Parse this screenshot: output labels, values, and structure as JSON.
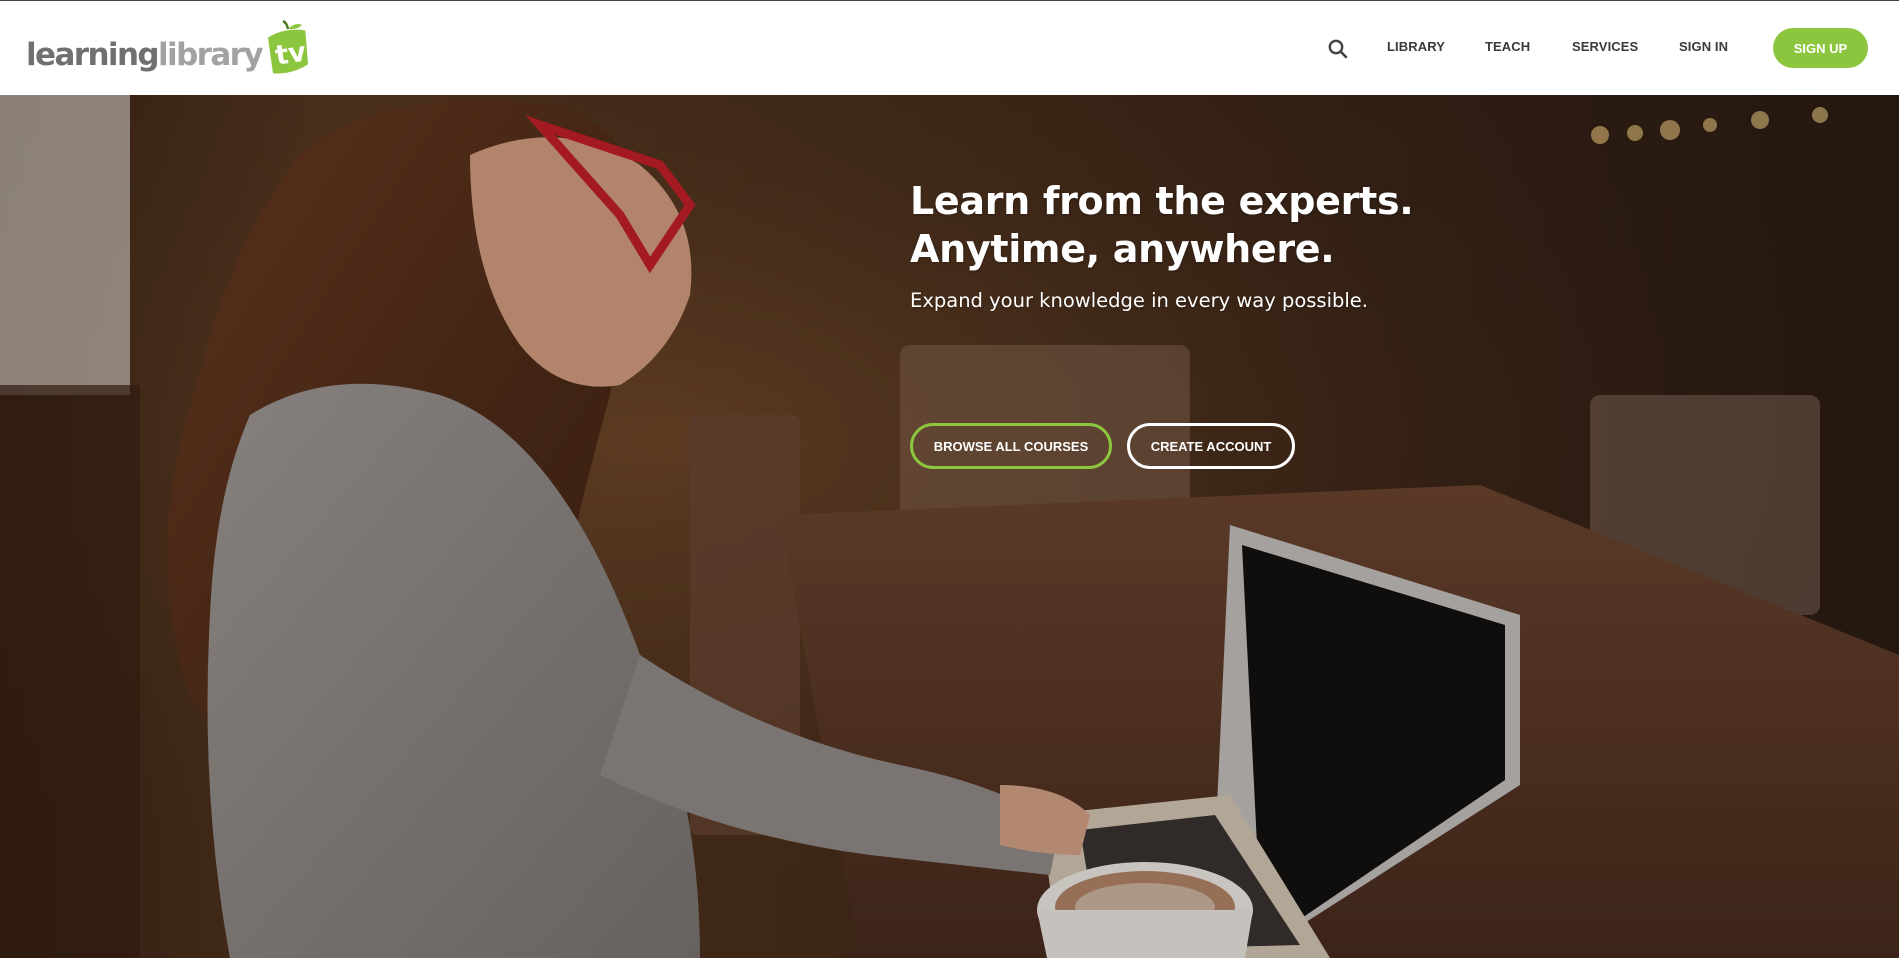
{
  "brand": {
    "logo_part1": "learning",
    "logo_part2": "library",
    "logo_part3": "tv",
    "accent": "#8cc63f"
  },
  "nav": {
    "search_icon": "search-icon",
    "items": [
      {
        "label": "LIBRARY"
      },
      {
        "label": "TEACH"
      },
      {
        "label": "SERVICES"
      },
      {
        "label": "SIGN IN"
      }
    ],
    "signup_label": "SIGN UP"
  },
  "hero": {
    "title_line1": "Learn from the experts.",
    "title_line2": "Anytime, anywhere.",
    "subtitle": "Expand your knowledge in every way possible.",
    "browse_label": "BROWSE ALL COURSES",
    "create_label": "CREATE ACCOUNT"
  }
}
